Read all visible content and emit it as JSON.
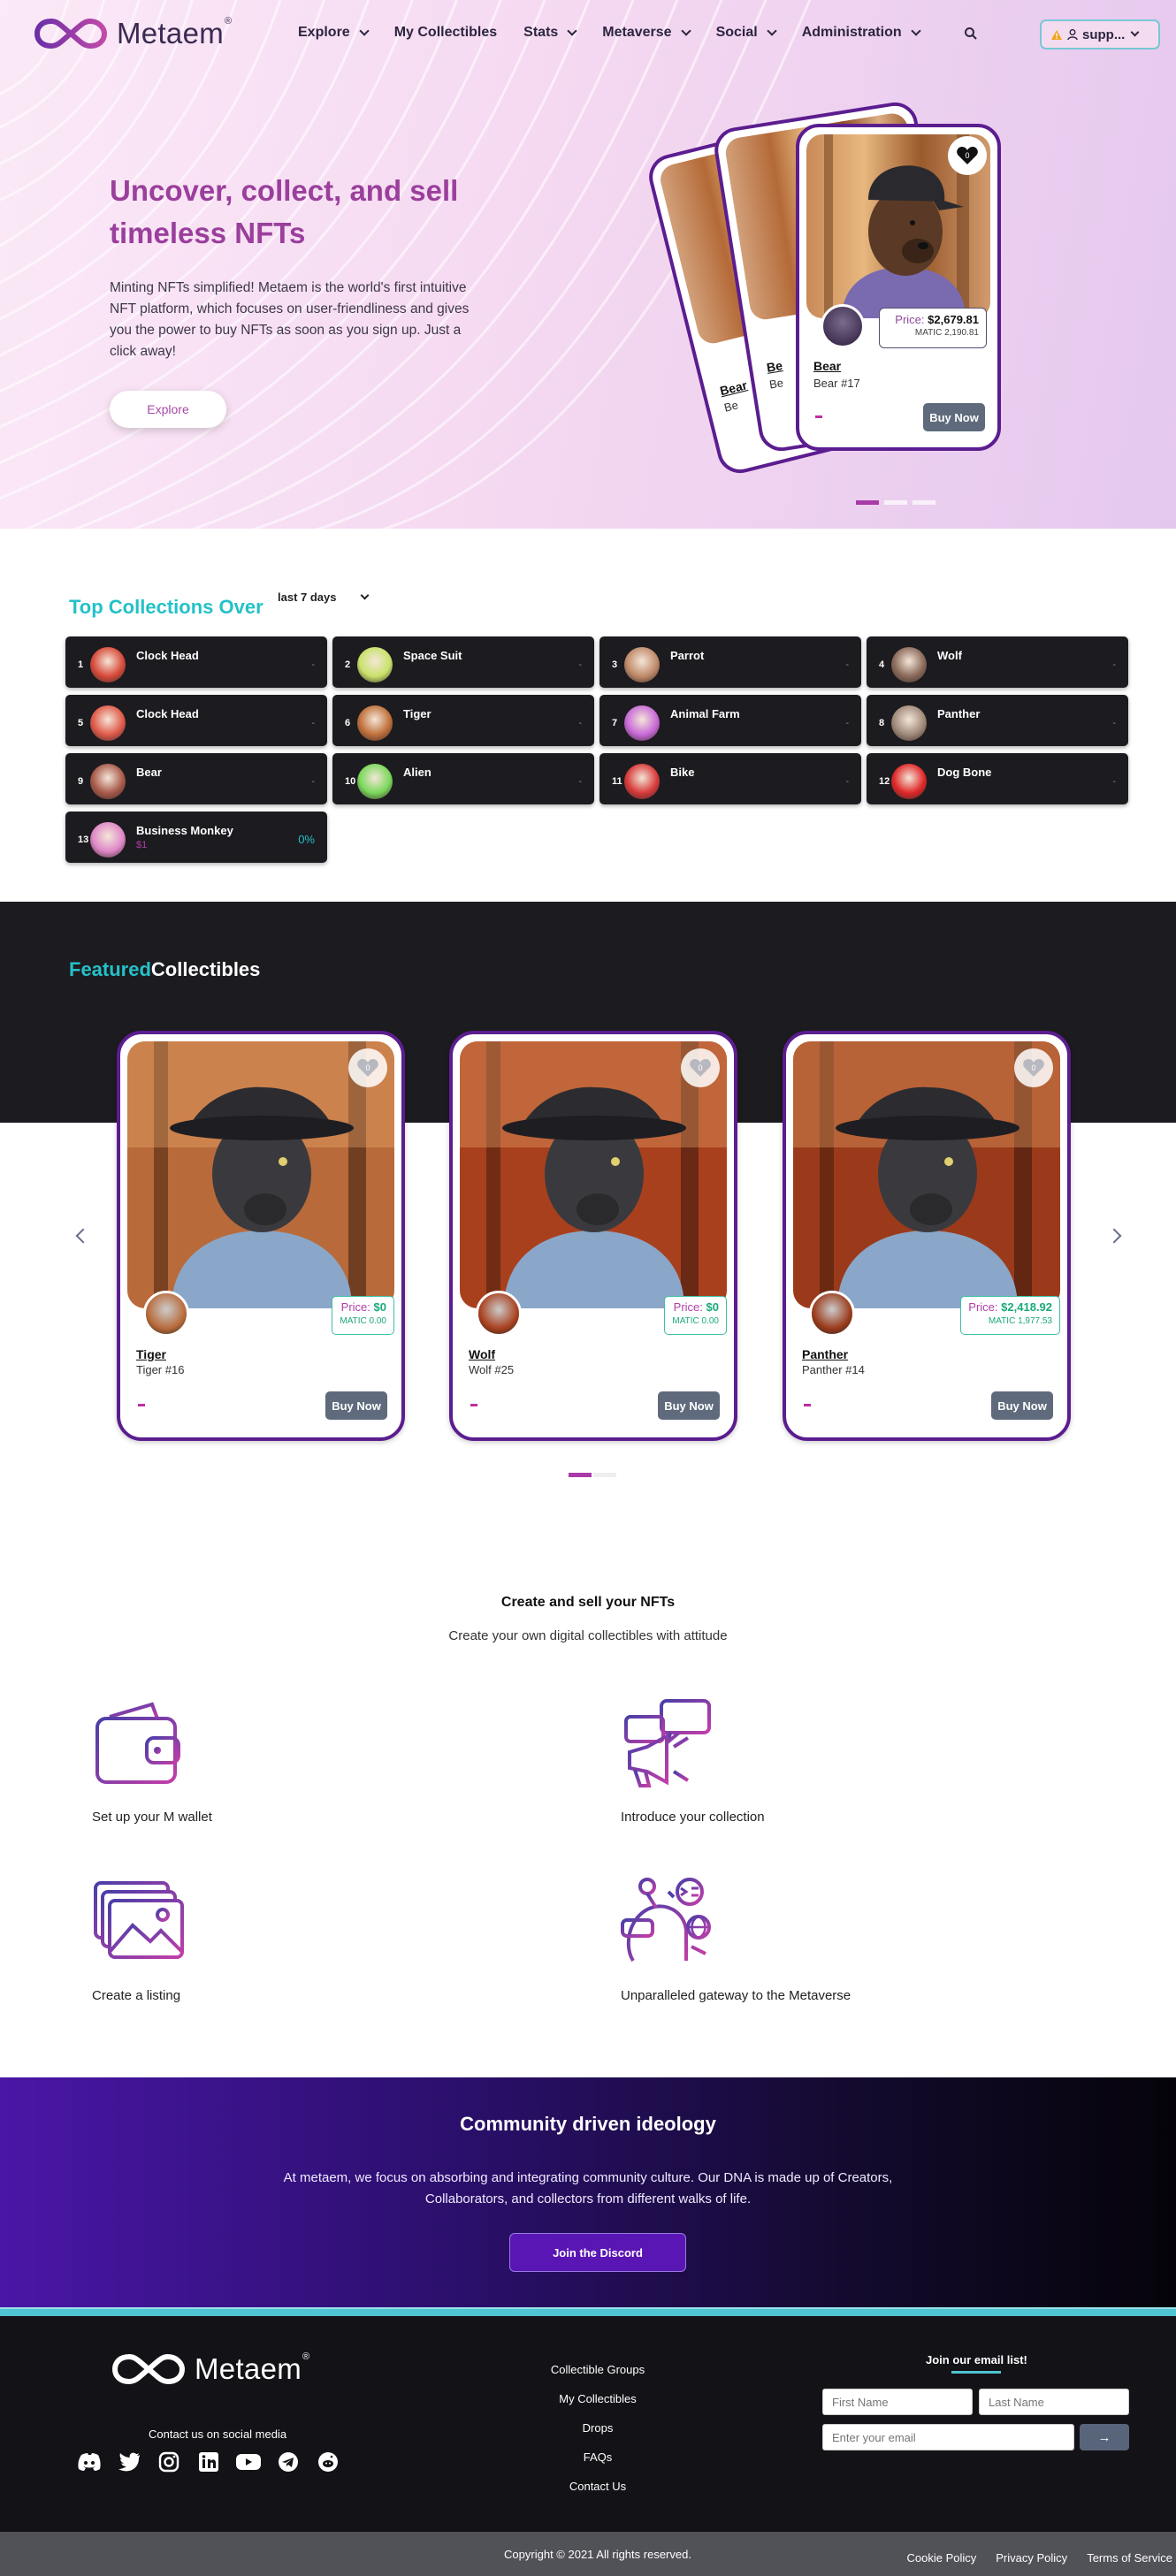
{
  "brand": {
    "name": "Metaem",
    "reg": "®"
  },
  "nav": {
    "items": [
      {
        "label": "Explore",
        "has_menu": true
      },
      {
        "label": "My Collectibles",
        "has_menu": false
      },
      {
        "label": "Stats",
        "has_menu": true
      },
      {
        "label": "Metaverse",
        "has_menu": true
      },
      {
        "label": "Social",
        "has_menu": true
      },
      {
        "label": "Administration",
        "has_menu": true
      }
    ],
    "search_icon": "search-icon",
    "user_label": "supp..."
  },
  "hero": {
    "title": "Uncover, collect, and sell timeless NFTs",
    "description": "Minting NFTs simplified! Metaem is the world's first intuitive NFT platform, which focuses on user-friendliness and gives you the power to buy NFTs as soon as you sign up. Just a click away!",
    "cta": "Explore",
    "card": {
      "likes": "0",
      "price_label": "Price:",
      "price": "$2,679.81",
      "matic": "MATIC 2,190.81",
      "name": "Bear",
      "subtitle": "Bear #17",
      "buy": "Buy Now"
    },
    "back_cards": [
      {
        "name": "Bear",
        "subtitle": "Be"
      },
      {
        "name": "Be",
        "subtitle": "Be"
      }
    ],
    "slides": 3,
    "active_slide": 0
  },
  "top_collections": {
    "title": "Top Collections Over",
    "period": "last 7 days",
    "items": [
      {
        "rank": "1",
        "name": "Clock Head",
        "change": "-",
        "color": "#d84a3a"
      },
      {
        "rank": "2",
        "name": "Space Suit",
        "change": "-",
        "color": "#c8e26a"
      },
      {
        "rank": "3",
        "name": "Parrot",
        "change": "-",
        "color": "#c08a6a"
      },
      {
        "rank": "4",
        "name": "Wolf",
        "change": "-",
        "color": "#8a6a5a"
      },
      {
        "rank": "5",
        "name": "Clock Head",
        "change": "-",
        "color": "#e05a4a"
      },
      {
        "rank": "6",
        "name": "Tiger",
        "change": "-",
        "color": "#c0703a"
      },
      {
        "rank": "7",
        "name": "Animal Farm",
        "change": "-",
        "color": "#c86ad8"
      },
      {
        "rank": "8",
        "name": "Panther",
        "change": "-",
        "color": "#a08a7a"
      },
      {
        "rank": "9",
        "name": "Bear",
        "change": "-",
        "color": "#a85a4a"
      },
      {
        "rank": "10",
        "name": "Alien",
        "change": "-",
        "color": "#7ad85a"
      },
      {
        "rank": "11",
        "name": "Bike",
        "change": "-",
        "color": "#d83a3a"
      },
      {
        "rank": "12",
        "name": "Dog Bone",
        "change": "-",
        "color": "#e02828"
      },
      {
        "rank": "13",
        "name": "Business Monkey",
        "change": "0%",
        "floor": "$1",
        "color": "#e088c8"
      }
    ]
  },
  "featured": {
    "title_a": "Featured",
    "title_b": "Collectibles",
    "cards": [
      {
        "name": "Tiger",
        "subtitle": "Tiger #16",
        "likes": "0",
        "price_label": "Price:",
        "price": "$0",
        "matic": "MATIC 0.00",
        "buy": "Buy Now",
        "bg": "#b86a3a"
      },
      {
        "name": "Wolf",
        "subtitle": "Wolf #25",
        "likes": "0",
        "price_label": "Price:",
        "price": "$0",
        "matic": "MATIC 0.00",
        "buy": "Buy Now",
        "bg": "#a8401e"
      },
      {
        "name": "Panther",
        "subtitle": "Panther #14",
        "likes": "0",
        "price_label": "Price:",
        "price": "$2,418.92",
        "matic": "MATIC 1,977.53",
        "buy": "Buy Now",
        "bg": "#9a3a1a"
      }
    ],
    "slides": 2,
    "active_slide": 0
  },
  "create": {
    "title": "Create and sell your NFTs",
    "subtitle": "Create your own digital collectibles with attitude",
    "steps": [
      {
        "label": "Set up your M wallet",
        "icon": "wallet-icon"
      },
      {
        "label": "Introduce your collection",
        "icon": "megaphone-icon"
      },
      {
        "label": "Create a listing",
        "icon": "image-stack-icon"
      },
      {
        "label": "Unparalleled gateway to the Metaverse",
        "icon": "vr-headset-icon"
      }
    ]
  },
  "community": {
    "title": "Community driven ideology",
    "description": "At metaem, we focus on absorbing and integrating community culture. Our DNA is made up of Creators, Collaborators, and collectors from different walks of life.",
    "cta": "Join the Discord"
  },
  "footer": {
    "contact": "Contact us on social media",
    "social": [
      "discord-icon",
      "twitter-icon",
      "instagram-icon",
      "linkedin-icon",
      "youtube-icon",
      "telegram-icon",
      "reddit-icon"
    ],
    "links": [
      "Collectible Groups",
      "My Collectibles",
      "Drops",
      "FAQs",
      "Contact Us"
    ],
    "mail_title": "Join our email list!",
    "first_name_ph": "First Name",
    "last_name_ph": "Last Name",
    "email_ph": "Enter your email",
    "send": "→",
    "copyright": "Copyright © 2021 All rights reserved.",
    "legal": [
      "Cookie Policy",
      "Privacy Policy",
      "Terms of Service"
    ]
  },
  "colors": {
    "accent": "#24c1c9",
    "brand_purple": "#5b1d8f",
    "title_purple": "#9a3f9c",
    "dark": "#1c1b1f"
  }
}
